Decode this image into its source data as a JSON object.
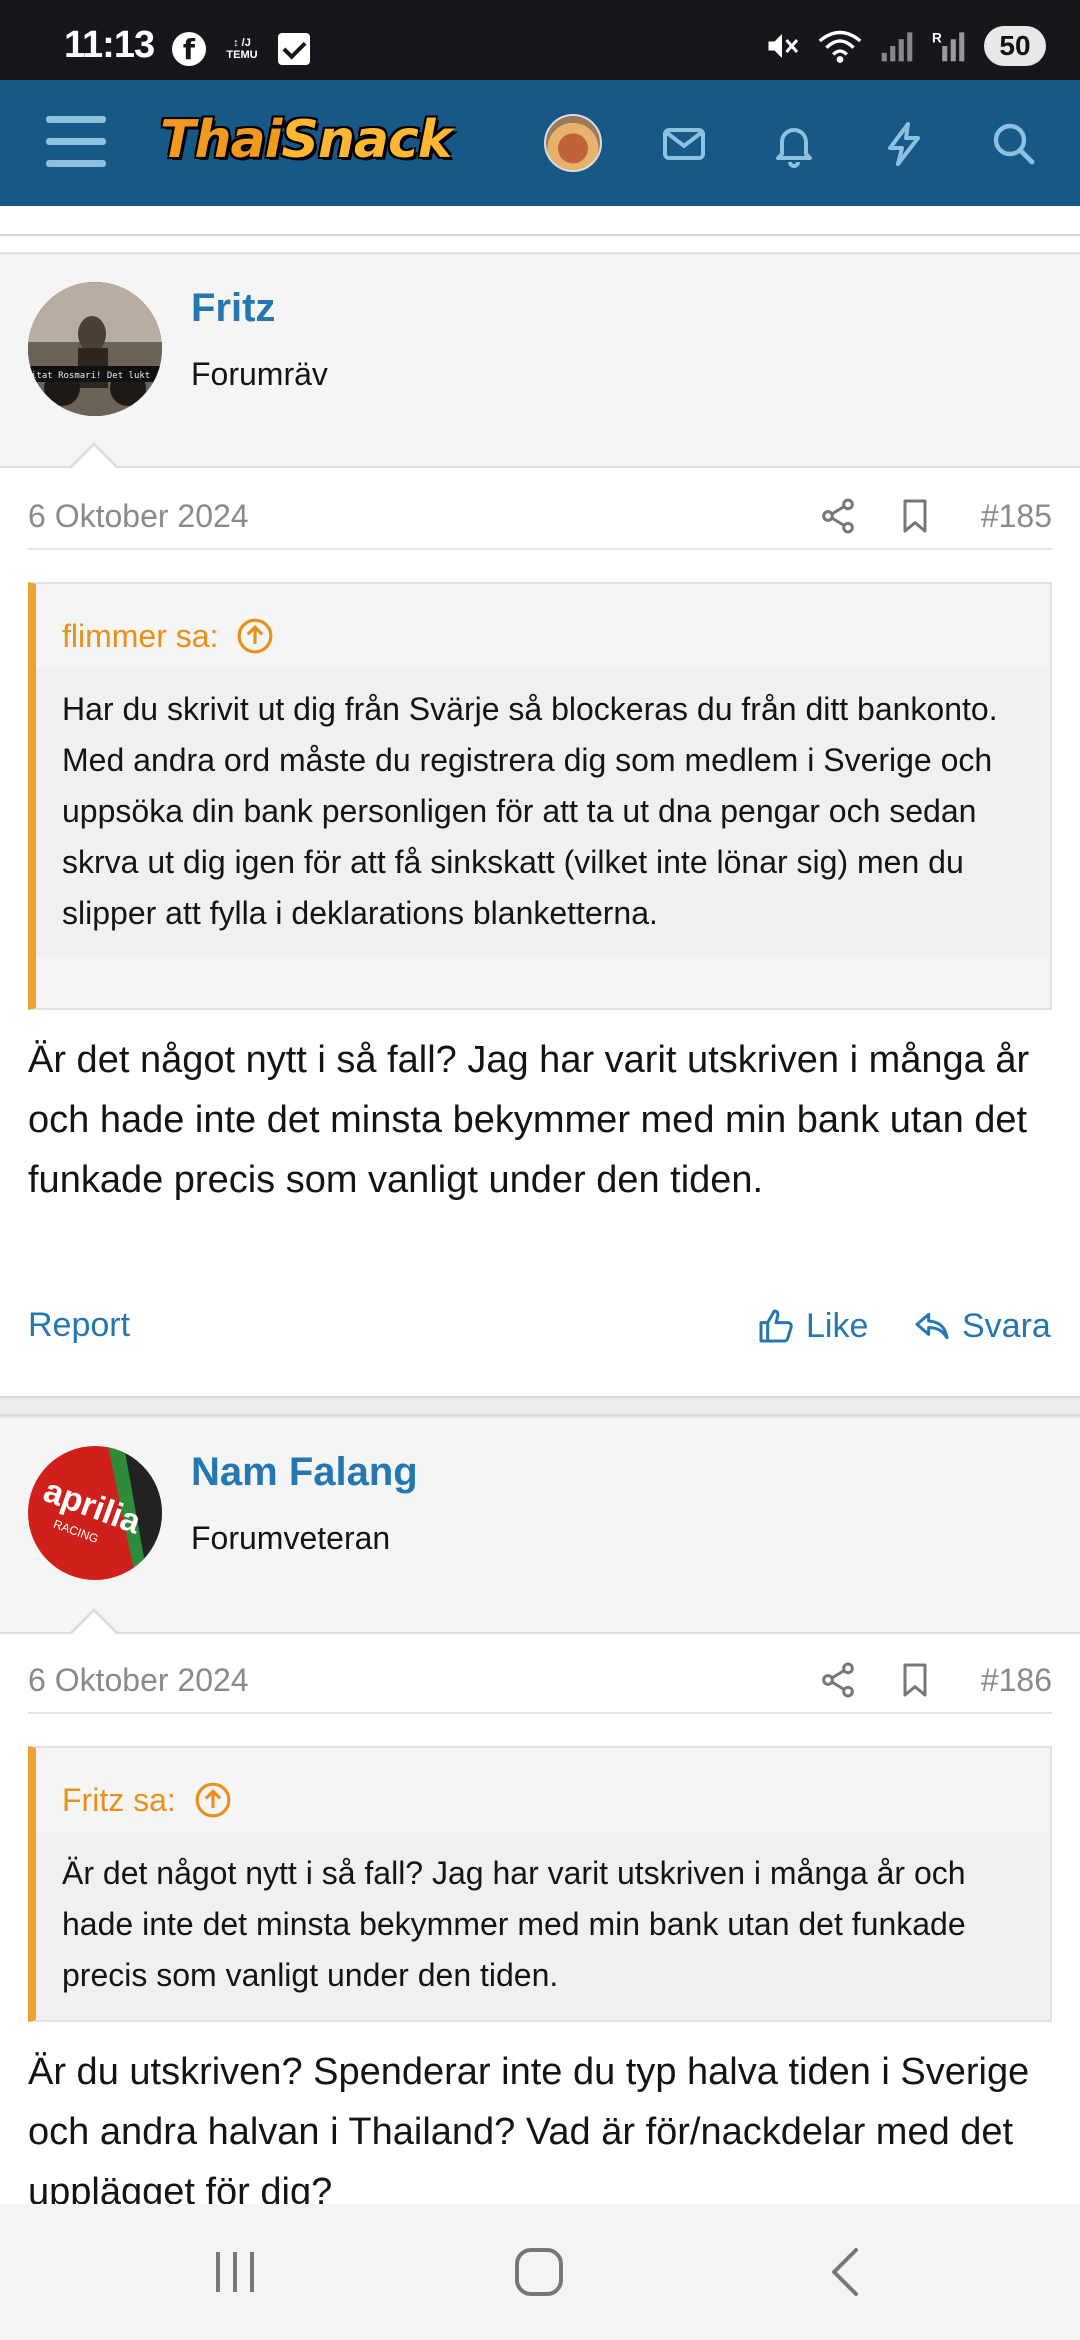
{
  "status_bar": {
    "time": "11:13",
    "temu_label": "↕ /J\nTEMU",
    "battery": "50"
  },
  "header": {
    "logo_part1": "Thai",
    "logo_part2": "Snack"
  },
  "posts": [
    {
      "author": "Fritz",
      "user_title": "Forumräv",
      "avatar_text": "itat Rosmari! Det lukt",
      "date": "6 Oktober 2024",
      "number": "#185",
      "quote_author": "flimmer sa:",
      "quote_text": "Har du skrivit ut dig från Svärje så blockeras du från ditt bankonto. Med andra ord måste du registrera dig som medlem i Sverige och uppsöka din bank personligen för att ta ut dna pengar och sedan skrva ut dig igen för att få sinkskatt (vilket inte lönar sig) men du slipper att fylla i deklarations blanketterna.",
      "body": "Är det något nytt i så fall? Jag har varit utskriven i många år och hade inte det minsta bekymmer med min bank utan det funkade precis som vanligt under den tiden.",
      "report_label": "Report",
      "like_label": "Like",
      "reply_label": "Svara"
    },
    {
      "author": "Nam Falang",
      "user_title": "Forumveteran",
      "avatar_text": "aprilia",
      "avatar_subtext": "RACING",
      "date": "6 Oktober 2024",
      "number": "#186",
      "quote_author": "Fritz sa:",
      "quote_text": "Är det något nytt i så fall? Jag har varit utskriven i många år och hade inte det minsta bekymmer med min bank utan det funkade precis som vanligt under den tiden.",
      "body": "Är du utskriven? Spenderar inte du typ halva tiden i Sverige och andra halvan i Thailand? Vad är för/nackdelar med det upplägget för dig?"
    }
  ],
  "colors": {
    "header_bg": "#185886",
    "link": "#2577b1",
    "quote_accent": "#f0a02c"
  },
  "icons": [
    "menu-icon",
    "inbox-icon",
    "bell-icon",
    "bolt-icon",
    "search-icon",
    "share-icon",
    "bookmark-icon",
    "arrow-up-circle-icon",
    "thumbs-up-icon",
    "reply-icon"
  ]
}
